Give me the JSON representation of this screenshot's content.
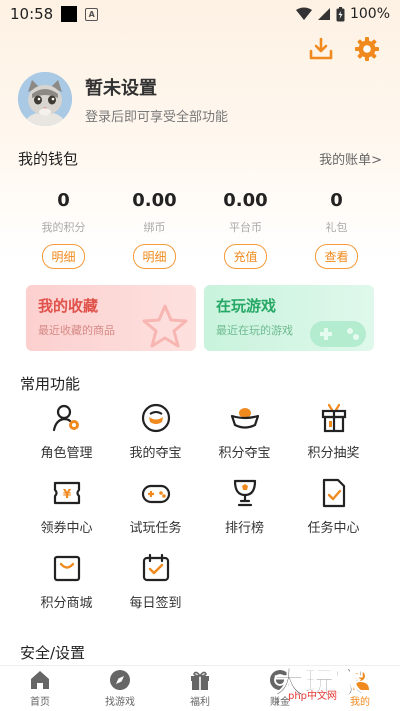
{
  "status_bar": {
    "time": "10:58",
    "a_icon": "A",
    "battery": "100%"
  },
  "profile": {
    "nickname": "暂未设置",
    "login_hint": "登录后即可享受全部功能"
  },
  "wallet": {
    "title": "我的钱包",
    "bill_link": "我的账单>",
    "items": [
      {
        "value": "0",
        "label": "我的积分",
        "button": "明细"
      },
      {
        "value": "0.00",
        "label": "绑币",
        "button": "明细"
      },
      {
        "value": "0.00",
        "label": "平台币",
        "button": "充值"
      },
      {
        "value": "0",
        "label": "礼包",
        "button": "查看"
      }
    ]
  },
  "cards": [
    {
      "title": "我的收藏",
      "subtitle": "最近收藏的商品"
    },
    {
      "title": "在玩游戏",
      "subtitle": "最近在玩的游戏"
    }
  ],
  "common": {
    "title": "常用功能",
    "items": [
      {
        "label": "角色管理",
        "icon": "user-gear-icon"
      },
      {
        "label": "我的夺宝",
        "icon": "treasure-icon"
      },
      {
        "label": "积分夺宝",
        "icon": "ingot-icon"
      },
      {
        "label": "积分抽奖",
        "icon": "gift-box-icon"
      },
      {
        "label": "领券中心",
        "icon": "coupon-icon"
      },
      {
        "label": "试玩任务",
        "icon": "gamepad-icon"
      },
      {
        "label": "排行榜",
        "icon": "trophy-icon"
      },
      {
        "label": "任务中心",
        "icon": "task-doc-icon"
      },
      {
        "label": "积分商城",
        "icon": "shopping-bag-icon"
      },
      {
        "label": "每日签到",
        "icon": "calendar-check-icon"
      }
    ]
  },
  "safety": {
    "title": "安全/设置"
  },
  "tabbar": [
    {
      "label": "首页",
      "icon": "home-icon"
    },
    {
      "label": "找游戏",
      "icon": "compass-icon"
    },
    {
      "label": "福利",
      "icon": "gift-icon"
    },
    {
      "label": "赚金",
      "icon": "coin-icon"
    },
    {
      "label": "我的",
      "icon": "user-icon"
    }
  ],
  "watermark": {
    "text": "大玩家",
    "site": "php中文网"
  },
  "colors": {
    "accent": "#f08a1e",
    "fav": "#e0524b",
    "play": "#27a866"
  }
}
